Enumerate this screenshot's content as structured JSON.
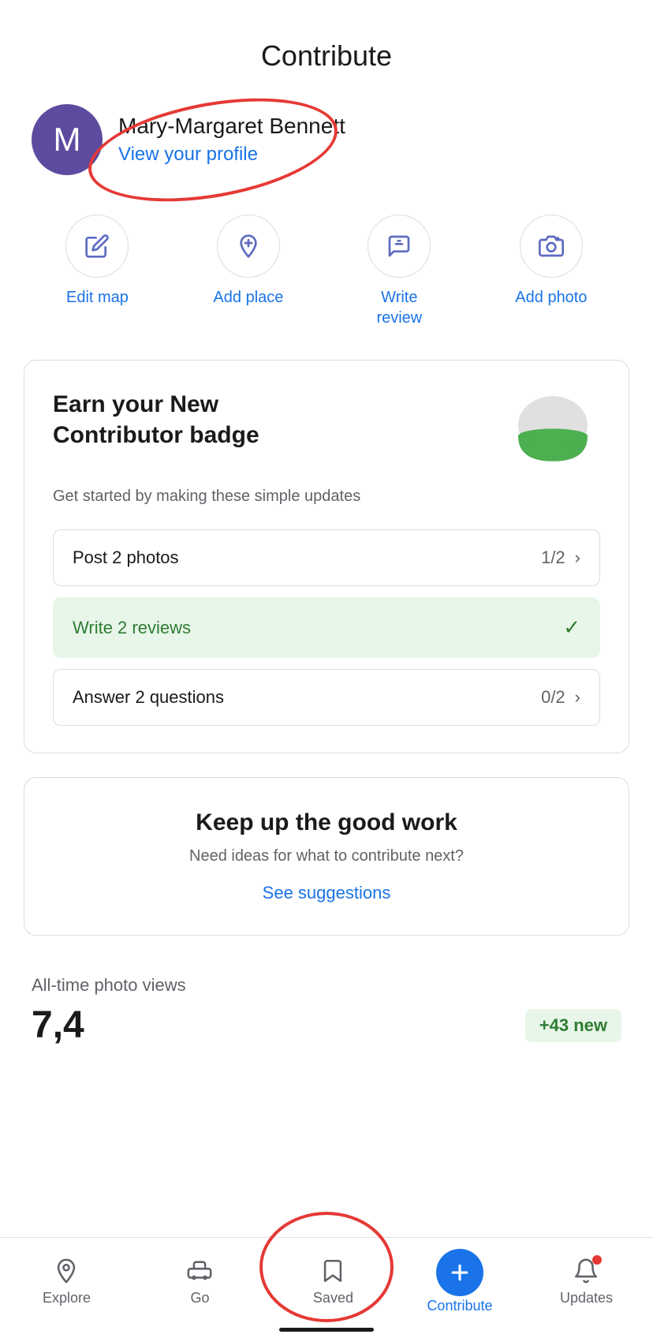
{
  "header": {
    "title": "Contribute"
  },
  "profile": {
    "avatar_letter": "M",
    "user_name": "Mary-Margaret Bennett",
    "view_profile_label": "View your profile"
  },
  "actions": [
    {
      "id": "edit-map",
      "label": "Edit map"
    },
    {
      "id": "add-place",
      "label": "Add place"
    },
    {
      "id": "write-review",
      "label": "Write\nreview"
    },
    {
      "id": "add-photo",
      "label": "Add photo"
    }
  ],
  "badge_card": {
    "title": "Earn your New Contributor badge",
    "subtitle": "Get started by making these simple updates",
    "tasks": [
      {
        "id": "post-photos",
        "label": "Post 2 photos",
        "progress": "1/2",
        "completed": false
      },
      {
        "id": "write-reviews",
        "label": "Write 2 reviews",
        "progress": null,
        "completed": true
      },
      {
        "id": "answer-questions",
        "label": "Answer 2 questions",
        "progress": "0/2",
        "completed": false
      }
    ]
  },
  "keep_up_card": {
    "title": "Keep up the good work",
    "subtitle": "Need ideas for what to contribute next?",
    "link_label": "See suggestions"
  },
  "photo_views": {
    "label": "All-time photo views",
    "count": "7,4...",
    "new_badge": "+43 new"
  },
  "bottom_nav": {
    "items": [
      {
        "id": "explore",
        "label": "Explore"
      },
      {
        "id": "go",
        "label": "Go"
      },
      {
        "id": "saved",
        "label": "Saved"
      },
      {
        "id": "contribute",
        "label": "Contribute",
        "active": true
      },
      {
        "id": "updates",
        "label": "Updates"
      }
    ]
  }
}
